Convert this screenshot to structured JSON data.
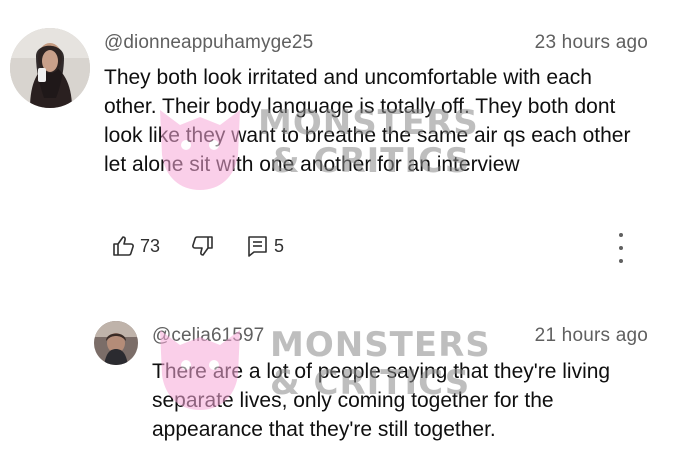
{
  "comments": [
    {
      "handle": "@dionneappuhamyge25",
      "time": "23 hours ago",
      "text": "They both look irritated and uncomfortable with each other. Their body language is totally off. They both dont look like they want to breathe the same air qs each other let alone sit with one another for an interview",
      "likes": "73",
      "replies": "5"
    },
    {
      "handle": "@celia61597",
      "time": "21 hours ago",
      "text": "There are a lot of people saying that they're living separate lives, only coming together for the appearance that they're still together."
    }
  ],
  "watermark": {
    "line1": "MONSTERS",
    "line2": "& CRITICS",
    "color": "#f7a8d8"
  },
  "icons": {
    "like": "thumbs-up-icon",
    "dislike": "thumbs-down-icon",
    "reply": "comment-icon",
    "more": "more-vert-icon"
  }
}
